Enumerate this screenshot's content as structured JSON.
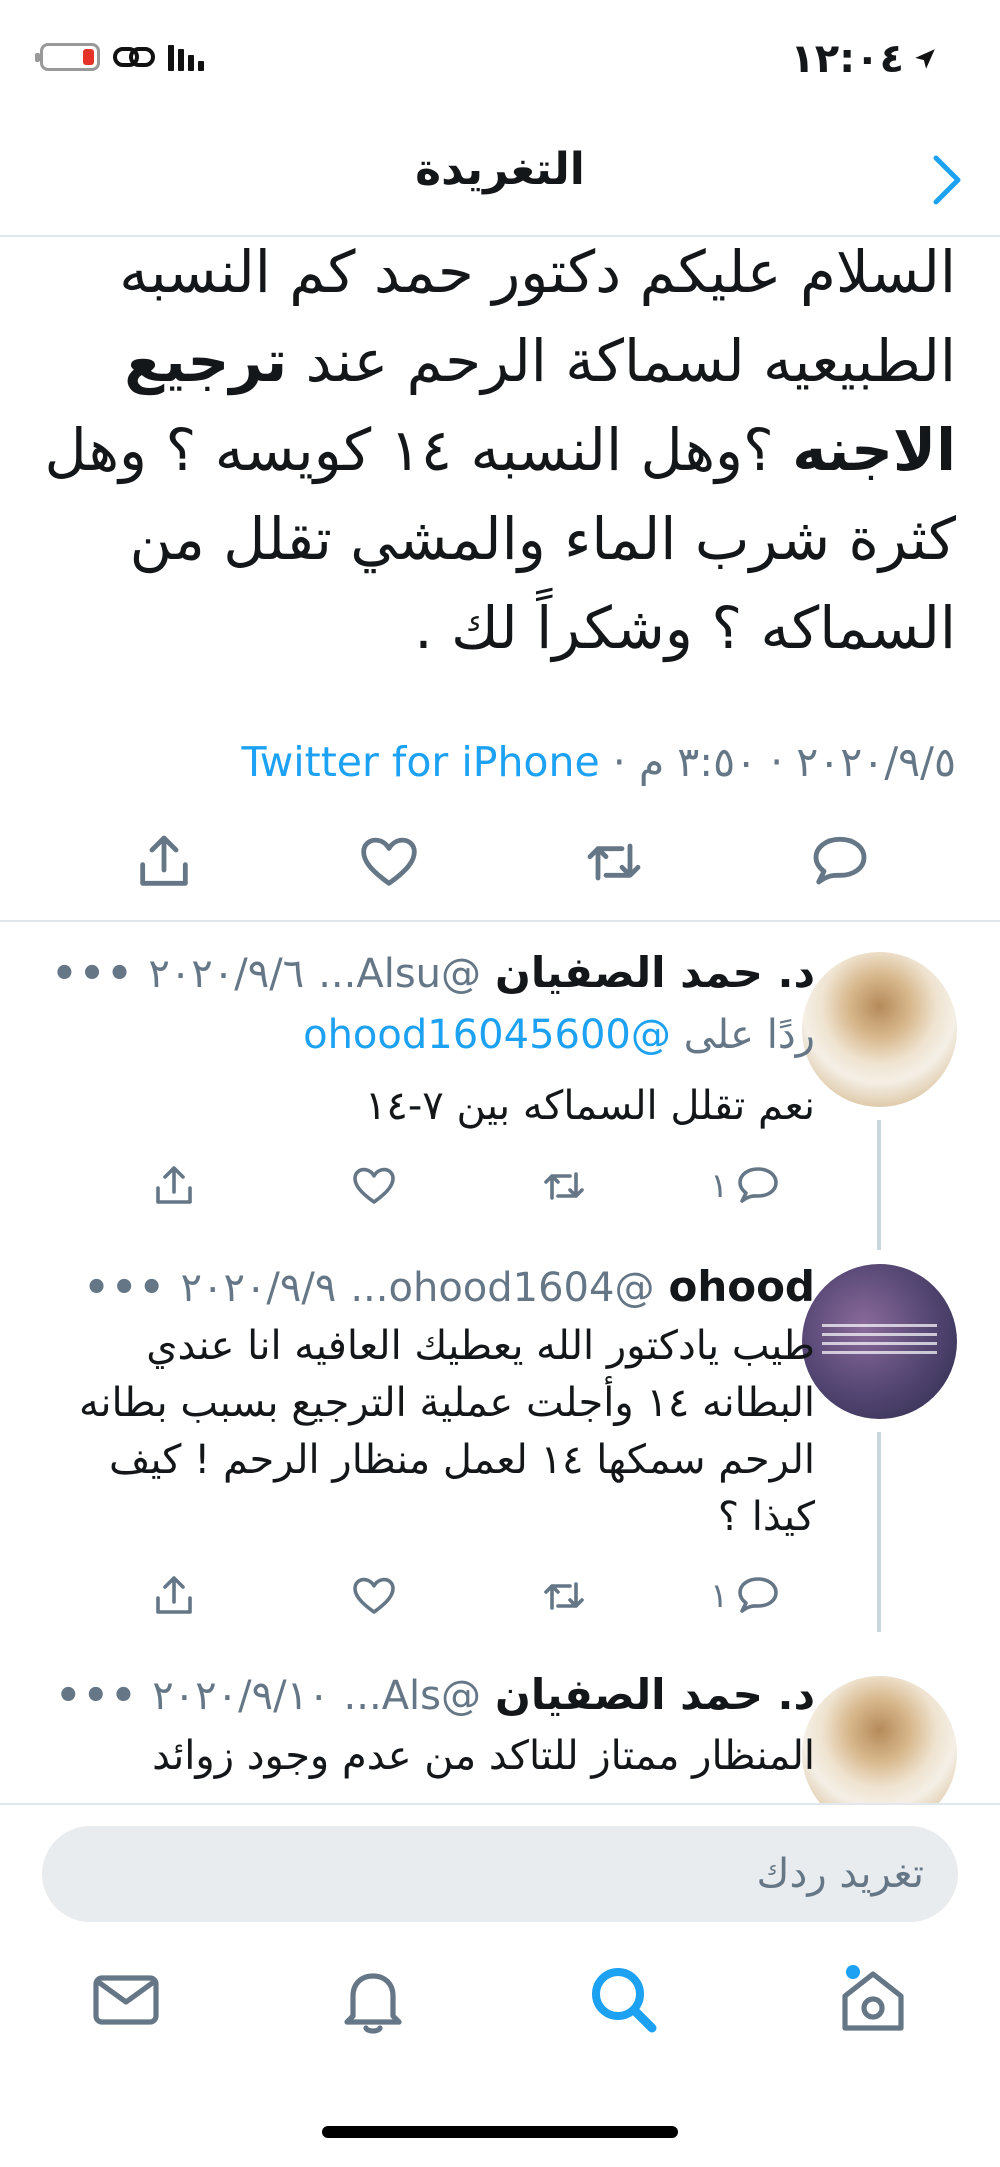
{
  "status_bar": {
    "time": "١٢:٠٤"
  },
  "header": {
    "title": "التغريدة"
  },
  "main_tweet": {
    "text_part1": "السلام عليكم دكتور حمد كم النسبه الطبيعيه لسماكة الرحم عند ",
    "text_bold1": "ترجيع",
    "text_bold2": "الاجنه",
    "text_part2": " ؟وهل النسبه ١٤ كويسه ؟ وهل كثرة شرب الماء والمشي تقلل من السماكه ؟ وشكراً لك .",
    "meta_date": "٢٠٢٠/٩/٥ · ٣:٥٠ م · ",
    "meta_source": "Twitter for iPhone"
  },
  "replies": [
    {
      "name": "د. حمد الصفيان",
      "handle": "@Alsu...",
      "date": "٢٠٢٠/٩/٦",
      "more": "•••",
      "reply_to_prefix": "ردًا على ",
      "reply_to_handle": "@ohood16045600",
      "body": "نعم تقلل السماكه بين ٧-١٤",
      "reply_count": "١"
    },
    {
      "name": "ohood",
      "handle": "@ohood1604...",
      "date": "٢٠٢٠/٩/٩",
      "more": "•••",
      "body": "طيب يادكتور الله يعطيك العافيه انا عندي البطانه ١٤ وأجلت عملية الترجيع بسبب بطانه الرحم سمكها ١٤ لعمل منظار الرحم ! كيف كيذا ؟",
      "reply_count": "١"
    },
    {
      "name": "د. حمد الصفيان",
      "handle": "@Als...",
      "date": "٢٠٢٠/٩/١٠",
      "more": "•••",
      "body": "المنظار ممتاز للتاكد من عدم وجود زوائد"
    }
  ],
  "composer": {
    "placeholder": "تغريد ردك"
  },
  "colors": {
    "accent": "#1da1f2",
    "secondary_text": "#657786",
    "divider": "#e1e8ed"
  }
}
